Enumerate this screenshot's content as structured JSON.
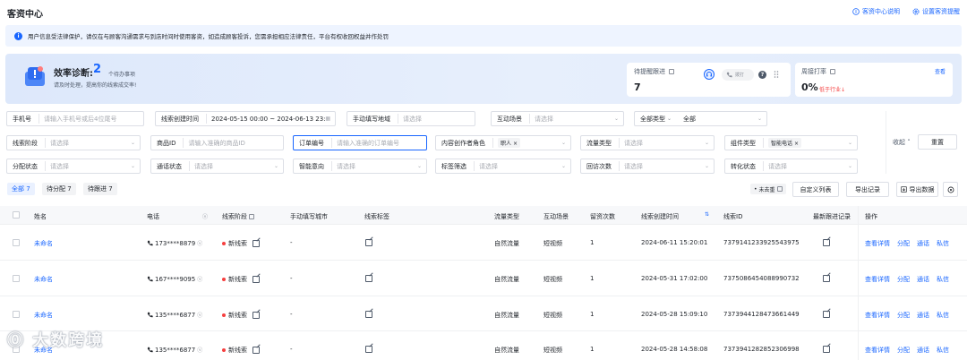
{
  "page": {
    "title": "客资中心",
    "links": [
      {
        "icon": "info-circle-icon",
        "label": "客资中心说明"
      },
      {
        "icon": "gear-icon",
        "label": "设置客资提醒"
      }
    ]
  },
  "notice": {
    "text": "用户信息受法律保护，请仅在与顾客沟通需求与到店时间时使用客资，如造成顾客投诉，您需承担相应法律责任，平台有权收回权益并作处罚"
  },
  "efficiency": {
    "label": "效率诊断:",
    "count": "2",
    "unit": "个待办事项",
    "subtitle": "请及时处理，提高你的线索成交率!"
  },
  "pending_card": {
    "label": "待提醒跟进",
    "value": "7",
    "call_label": "拨打"
  },
  "rate_card": {
    "label": "周接打率",
    "view_label": "查看",
    "value": "0%",
    "compare": "低于行业"
  },
  "filters": {
    "row1": [
      {
        "label": "手机号",
        "placeholder": "请输入手机号或后4位尾号"
      },
      {
        "label": "线索创建时间",
        "value": "2024-05-15 00:00 ~ 2024-06-13 23:59"
      },
      {
        "label": "手动填写地域",
        "placeholder": "请选择"
      },
      {
        "label": "互动场景",
        "placeholder": "请选择"
      },
      {
        "label": "全部类型",
        "value": "全部"
      }
    ],
    "row2": [
      {
        "label": "线索阶段",
        "placeholder": "请选择"
      },
      {
        "label": "商品ID",
        "placeholder": "请输入准确的商品ID"
      },
      {
        "label": "订单编号",
        "placeholder": "请输入准确的订单编号"
      },
      {
        "label": "内容创作者角色",
        "tag": "职人"
      },
      {
        "label": "流量类型",
        "placeholder": "请选择"
      },
      {
        "label": "组件类型",
        "tag": "智能电话"
      }
    ],
    "row3": [
      {
        "label": "分配状态",
        "placeholder": "请选择"
      },
      {
        "label": "通话状态",
        "placeholder": "请选择"
      },
      {
        "label": "智能意向",
        "placeholder": "请选择"
      },
      {
        "label": "标签筛选",
        "placeholder": "请选择"
      },
      {
        "label": "回访次数",
        "placeholder": "请选择"
      },
      {
        "label": "转化状态",
        "placeholder": "请选择"
      }
    ],
    "collapse_label": "收起",
    "reset_label": "重置"
  },
  "tabs": [
    {
      "label": "全部 7",
      "active": true
    },
    {
      "label": "待分配 7",
      "active": false
    },
    {
      "label": "待跟进 7",
      "active": false
    }
  ],
  "toolbar": {
    "unread_label": "未去重",
    "custom_list_label": "自定义列表",
    "export_record_label": "导出记录",
    "export_data_label": "导出数据"
  },
  "table": {
    "columns": [
      "姓名",
      "电话",
      "线索阶段",
      "手动填写城市",
      "线索标签",
      "流量类型",
      "互动场景",
      "留资次数",
      "线索创建时间",
      "线索ID",
      "最新跟进记录",
      "操作"
    ],
    "actions": [
      "查看详情",
      "分配",
      "通话",
      "私信"
    ],
    "rows": [
      {
        "name": "未命名",
        "phone": "173****8879",
        "stage": "新线索",
        "city": "-",
        "traffic": "自然流量",
        "scene": "短视频",
        "times": "1",
        "created": "2024-06-11 15:20:01",
        "id": "7379141233925543975"
      },
      {
        "name": "未命名",
        "phone": "167****9095",
        "stage": "新线索",
        "city": "-",
        "traffic": "自然流量",
        "scene": "短视频",
        "times": "1",
        "created": "2024-05-31 17:02:00",
        "id": "7375086454088990732"
      },
      {
        "name": "未命名",
        "phone": "135****6877",
        "stage": "新线索",
        "city": "-",
        "traffic": "自然流量",
        "scene": "短视频",
        "times": "1",
        "created": "2024-05-28 15:09:10",
        "id": "7373944128473661449"
      },
      {
        "name": "未命名",
        "phone": "135****6877",
        "stage": "新线索",
        "city": "-",
        "traffic": "自然流量",
        "scene": "短视频",
        "times": "1",
        "created": "2024-05-28 14:58:08",
        "id": "7373941282852306998"
      }
    ]
  },
  "watermark": {
    "text": "大数跨境"
  }
}
